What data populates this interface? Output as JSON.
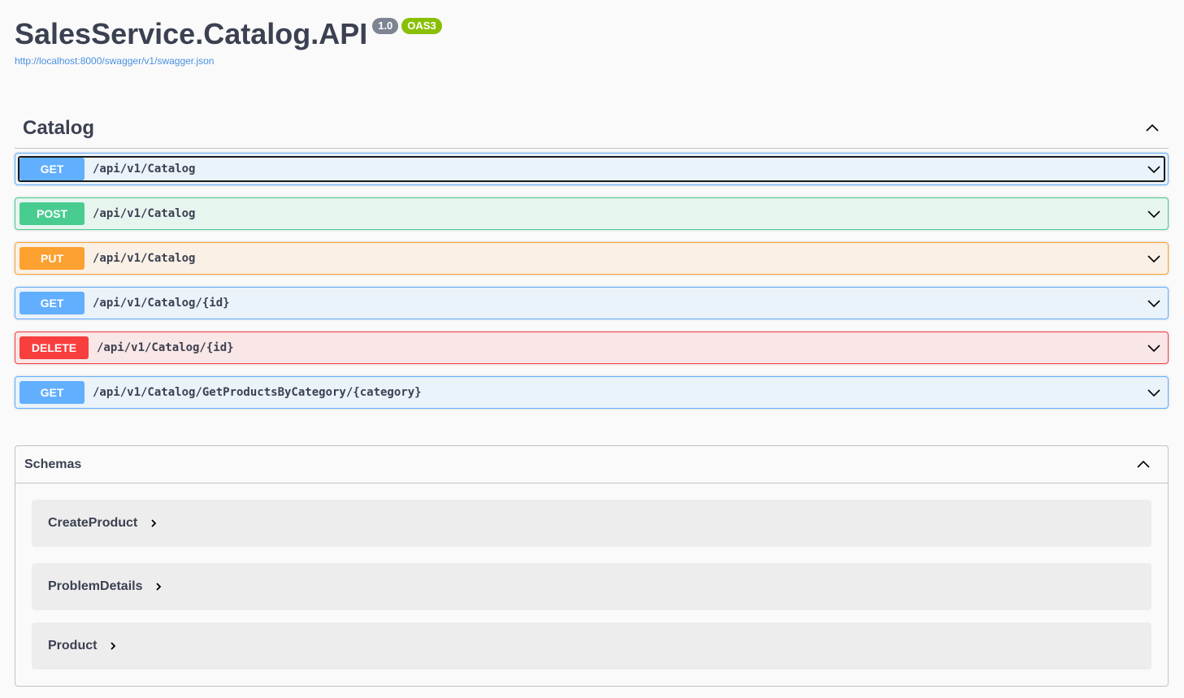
{
  "info": {
    "title": "SalesService.Catalog.API",
    "version": "1.0",
    "oas": "OAS3",
    "spec_url": "http://localhost:8000/swagger/v1/swagger.json"
  },
  "tag": {
    "name": "Catalog"
  },
  "operations": [
    {
      "method": "GET",
      "path": "/api/v1/Catalog"
    },
    {
      "method": "POST",
      "path": "/api/v1/Catalog"
    },
    {
      "method": "PUT",
      "path": "/api/v1/Catalog"
    },
    {
      "method": "GET",
      "path": "/api/v1/Catalog/{id}"
    },
    {
      "method": "DELETE",
      "path": "/api/v1/Catalog/{id}"
    },
    {
      "method": "GET",
      "path": "/api/v1/Catalog/GetProductsByCategory/{category}"
    }
  ],
  "schemas": {
    "title": "Schemas",
    "items": [
      {
        "name": "CreateProduct"
      },
      {
        "name": "ProblemDetails"
      },
      {
        "name": "Product"
      }
    ]
  },
  "colors": {
    "get": "#61affe",
    "post": "#49cc90",
    "put": "#fca130",
    "delete": "#f93e3e",
    "badge_version": "#7d8492",
    "badge_oas": "#89bf04",
    "link": "#4990e2"
  },
  "icons": {
    "collapse": "chevron-up-icon",
    "expand": "chevron-down-icon",
    "schema_expand": "chevron-right-icon"
  }
}
